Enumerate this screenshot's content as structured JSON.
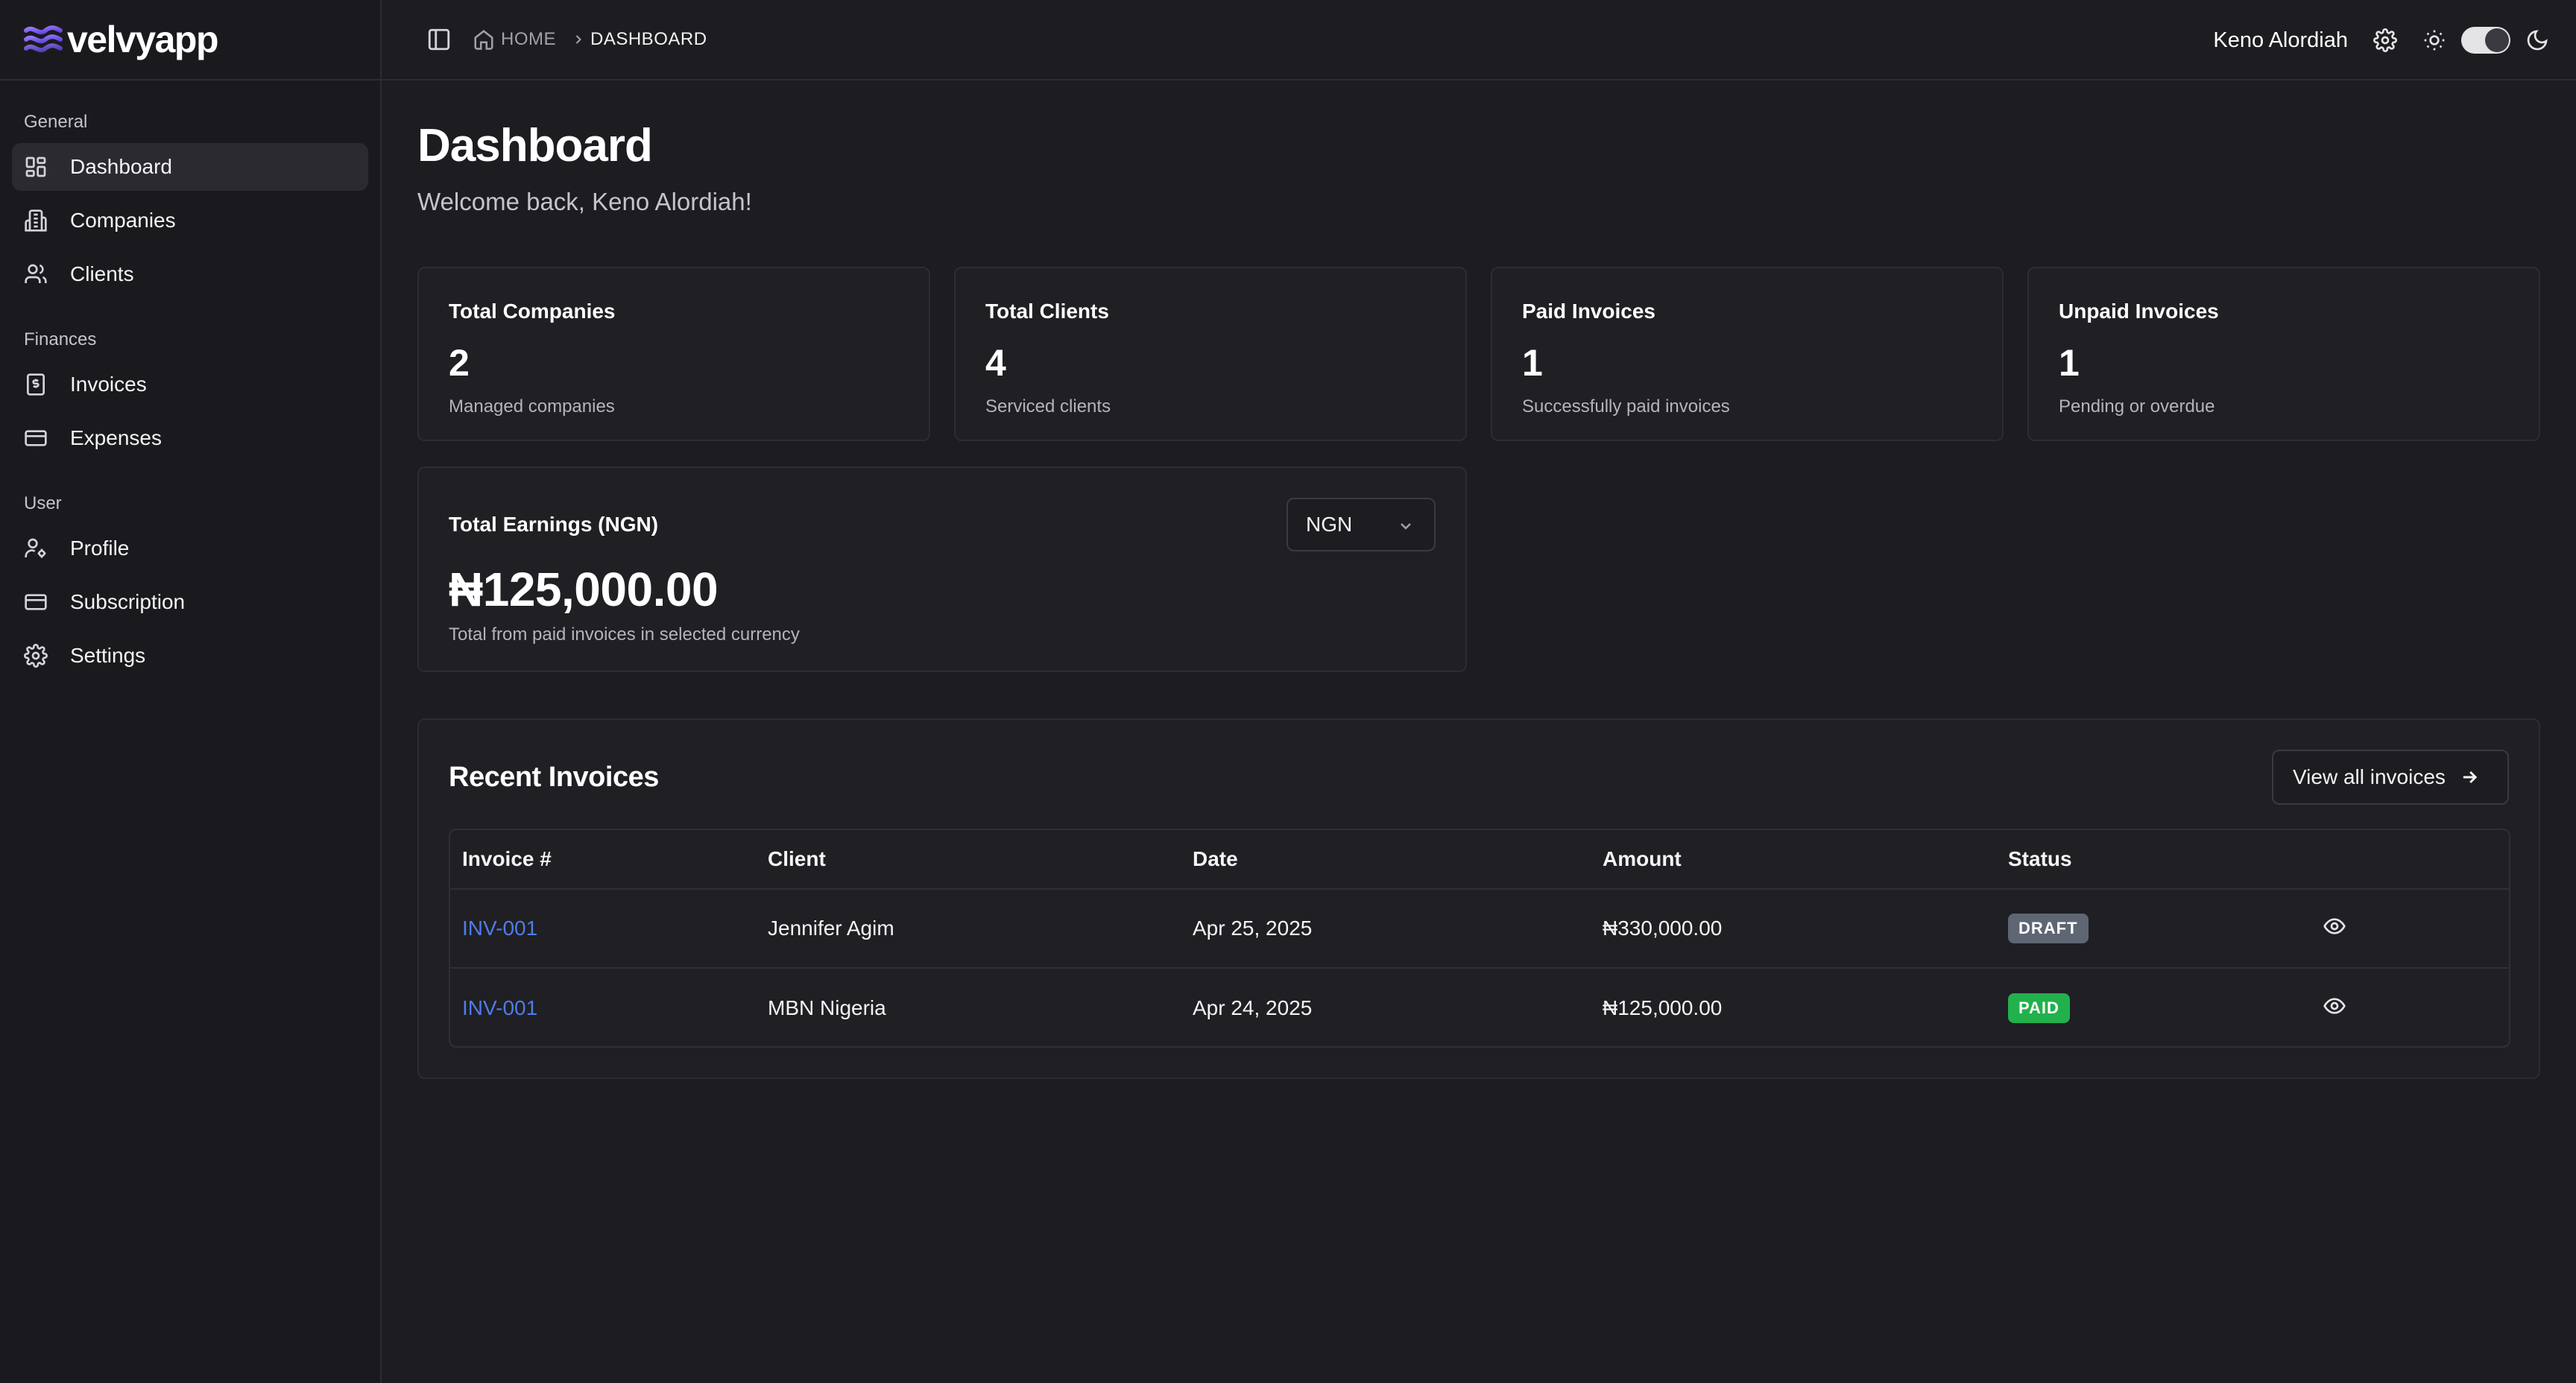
{
  "brand": {
    "name": "velvyapp",
    "accent": "#7b5cf5"
  },
  "sidebar": {
    "groups": [
      {
        "label": "General",
        "items": [
          {
            "label": "Dashboard",
            "icon": "layout-grid-icon",
            "active": true
          },
          {
            "label": "Companies",
            "icon": "building-icon"
          },
          {
            "label": "Clients",
            "icon": "users-icon"
          }
        ]
      },
      {
        "label": "Finances",
        "items": [
          {
            "label": "Invoices",
            "icon": "receipt-icon"
          },
          {
            "label": "Expenses",
            "icon": "credit-card-icon"
          }
        ]
      },
      {
        "label": "User",
        "items": [
          {
            "label": "Profile",
            "icon": "user-cog-icon"
          },
          {
            "label": "Subscription",
            "icon": "credit-card-icon"
          },
          {
            "label": "Settings",
            "icon": "gear-icon"
          }
        ]
      }
    ]
  },
  "header": {
    "breadcrumb": {
      "home": "HOME",
      "current": "DASHBOARD"
    },
    "user_name": "Keno Alordiah",
    "theme": "dark"
  },
  "page": {
    "title": "Dashboard",
    "subtitle": "Welcome back, Keno Alordiah!"
  },
  "stats": [
    {
      "title": "Total Companies",
      "value": "2",
      "desc": "Managed companies"
    },
    {
      "title": "Total Clients",
      "value": "4",
      "desc": "Serviced clients"
    },
    {
      "title": "Paid Invoices",
      "value": "1",
      "desc": "Successfully paid invoices"
    },
    {
      "title": "Unpaid Invoices",
      "value": "1",
      "desc": "Pending or overdue"
    }
  ],
  "earnings": {
    "title": "Total Earnings (NGN)",
    "value": "₦125,000.00",
    "desc": "Total from paid invoices in selected currency",
    "currency": "NGN"
  },
  "recent_invoices": {
    "title": "Recent Invoices",
    "view_all_label": "View all invoices",
    "columns": [
      "Invoice #",
      "Client",
      "Date",
      "Amount",
      "Status"
    ],
    "rows": [
      {
        "invoice": "INV-001",
        "client": "Jennifer Agim",
        "date": "Apr 25, 2025",
        "amount": "₦330,000.00",
        "status": "DRAFT",
        "status_color": "#5f6673"
      },
      {
        "invoice": "INV-001",
        "client": "MBN Nigeria",
        "date": "Apr 24, 2025",
        "amount": "₦125,000.00",
        "status": "PAID",
        "status_color": "#22b14c"
      }
    ]
  }
}
